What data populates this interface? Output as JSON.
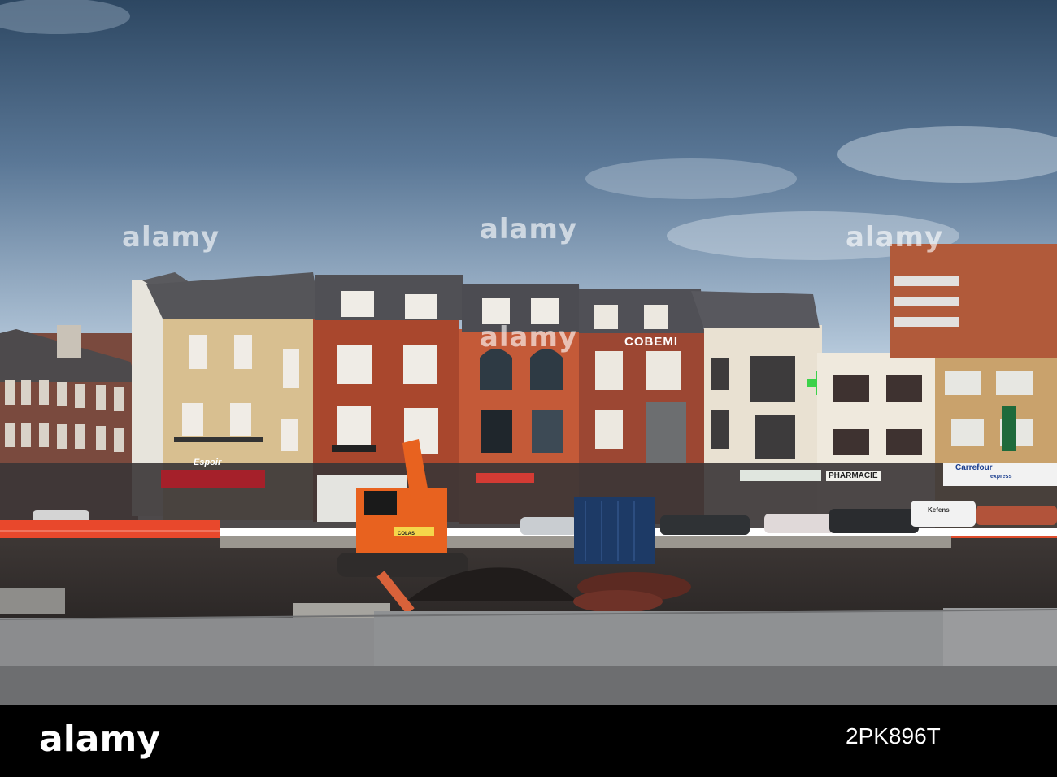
{
  "watermark": {
    "brand": "alamy"
  },
  "signs": {
    "cobemi": "COBEMI",
    "pharmacie": "PHARMACIE",
    "carrefour": "Carrefour",
    "carrefour_sub": "express",
    "cafe": "Espoir",
    "excavator_brand": "COLAS",
    "van": "Kefens"
  },
  "footer": {
    "logo": "alamy",
    "image_id": "2PK896T"
  },
  "colors": {
    "sky_top": "#2f4a66",
    "sky_bottom": "#a9c1d8",
    "excavator": "#e8621f",
    "container": "#1d3a66",
    "pharmacy_cross": "#3cd24a",
    "barrier": "#e8482c"
  }
}
